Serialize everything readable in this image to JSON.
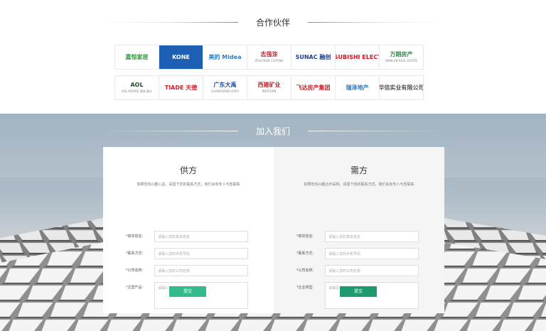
{
  "partners": {
    "title": "合作伙伴",
    "logos_row1": [
      {
        "name": "jiaheng",
        "text": "嘉恒家居",
        "color": "#2d9d3a"
      },
      {
        "name": "kone",
        "text": "KONE",
        "color": "#ffffff",
        "bg": "#1c5fb3"
      },
      {
        "name": "midea",
        "text": "美的 Midea",
        "color": "#2a7fd4"
      },
      {
        "name": "zhiqiangtu",
        "text": "志强涂",
        "sub": "ZEALTRON COATING",
        "color": "#c8232c"
      },
      {
        "name": "sunac",
        "text": "SUNAC 融创",
        "color": "#1a3f8f"
      },
      {
        "name": "mitsubishi",
        "text": "MITSUBISHI ELECTRIC",
        "color": "#d4141e"
      },
      {
        "name": "wanlang",
        "text": "万朗房产",
        "sub": "WANLON REAL ESTATE",
        "color": "#2c8b45"
      }
    ],
    "logos_row2": [
      {
        "name": "aol",
        "text": "AOL",
        "sub": "AOL-MOORE 奥林·莫尔",
        "color": "#1f4f2a"
      },
      {
        "name": "tiande",
        "text": "TIADE 天德",
        "color": "#c8232c"
      },
      {
        "name": "guangdong-dayu",
        "text": "广东大禹",
        "sub": "GUANGDONG DAYU",
        "color": "#1d4d9e"
      },
      {
        "name": "xijian",
        "text": "西建矿业",
        "sub": "WESTERN",
        "color": "#c8232c"
      },
      {
        "name": "feida",
        "text": "飞达房产集团",
        "color": "#d4141e"
      },
      {
        "name": "ruize",
        "text": "瑞泽地产",
        "color": "#2c78b8"
      },
      {
        "name": "huaxin",
        "text": "华信实业有限公司",
        "color": "#555555"
      }
    ]
  },
  "join": {
    "title": "加入我们",
    "supply": {
      "heading": "供方",
      "desc": "如果您有兴趣入驻，请留下您的联系方式，我们会有专人与您联系",
      "name_label": "*真实姓名：",
      "name_placeholder": "请输入您的真实姓名",
      "contact_label": "*联系方式：",
      "contact_placeholder": "请输入您的手机号码",
      "company_label": "*公司名称：",
      "company_placeholder": "请输入您的公司名称",
      "product_label": "*主营产品：",
      "product_placeholder": "请输入您公司的主营产品",
      "submit_label": "提交"
    },
    "demand": {
      "heading": "需方",
      "desc": "如果您有兴趣合作采购，请留下您的联系方式，我们会有专人与您联系",
      "name_label": "*真实姓名：",
      "name_placeholder": "请输入您的真实姓名",
      "contact_label": "*联系方式：",
      "contact_placeholder": "请输入您的手机号码",
      "company_label": "*公司名称：",
      "company_placeholder": "请输入您的公司名称",
      "type_label": "*企业类型：",
      "type_placeholder": "请填写公司的企业类型",
      "submit_label": "提交"
    }
  }
}
